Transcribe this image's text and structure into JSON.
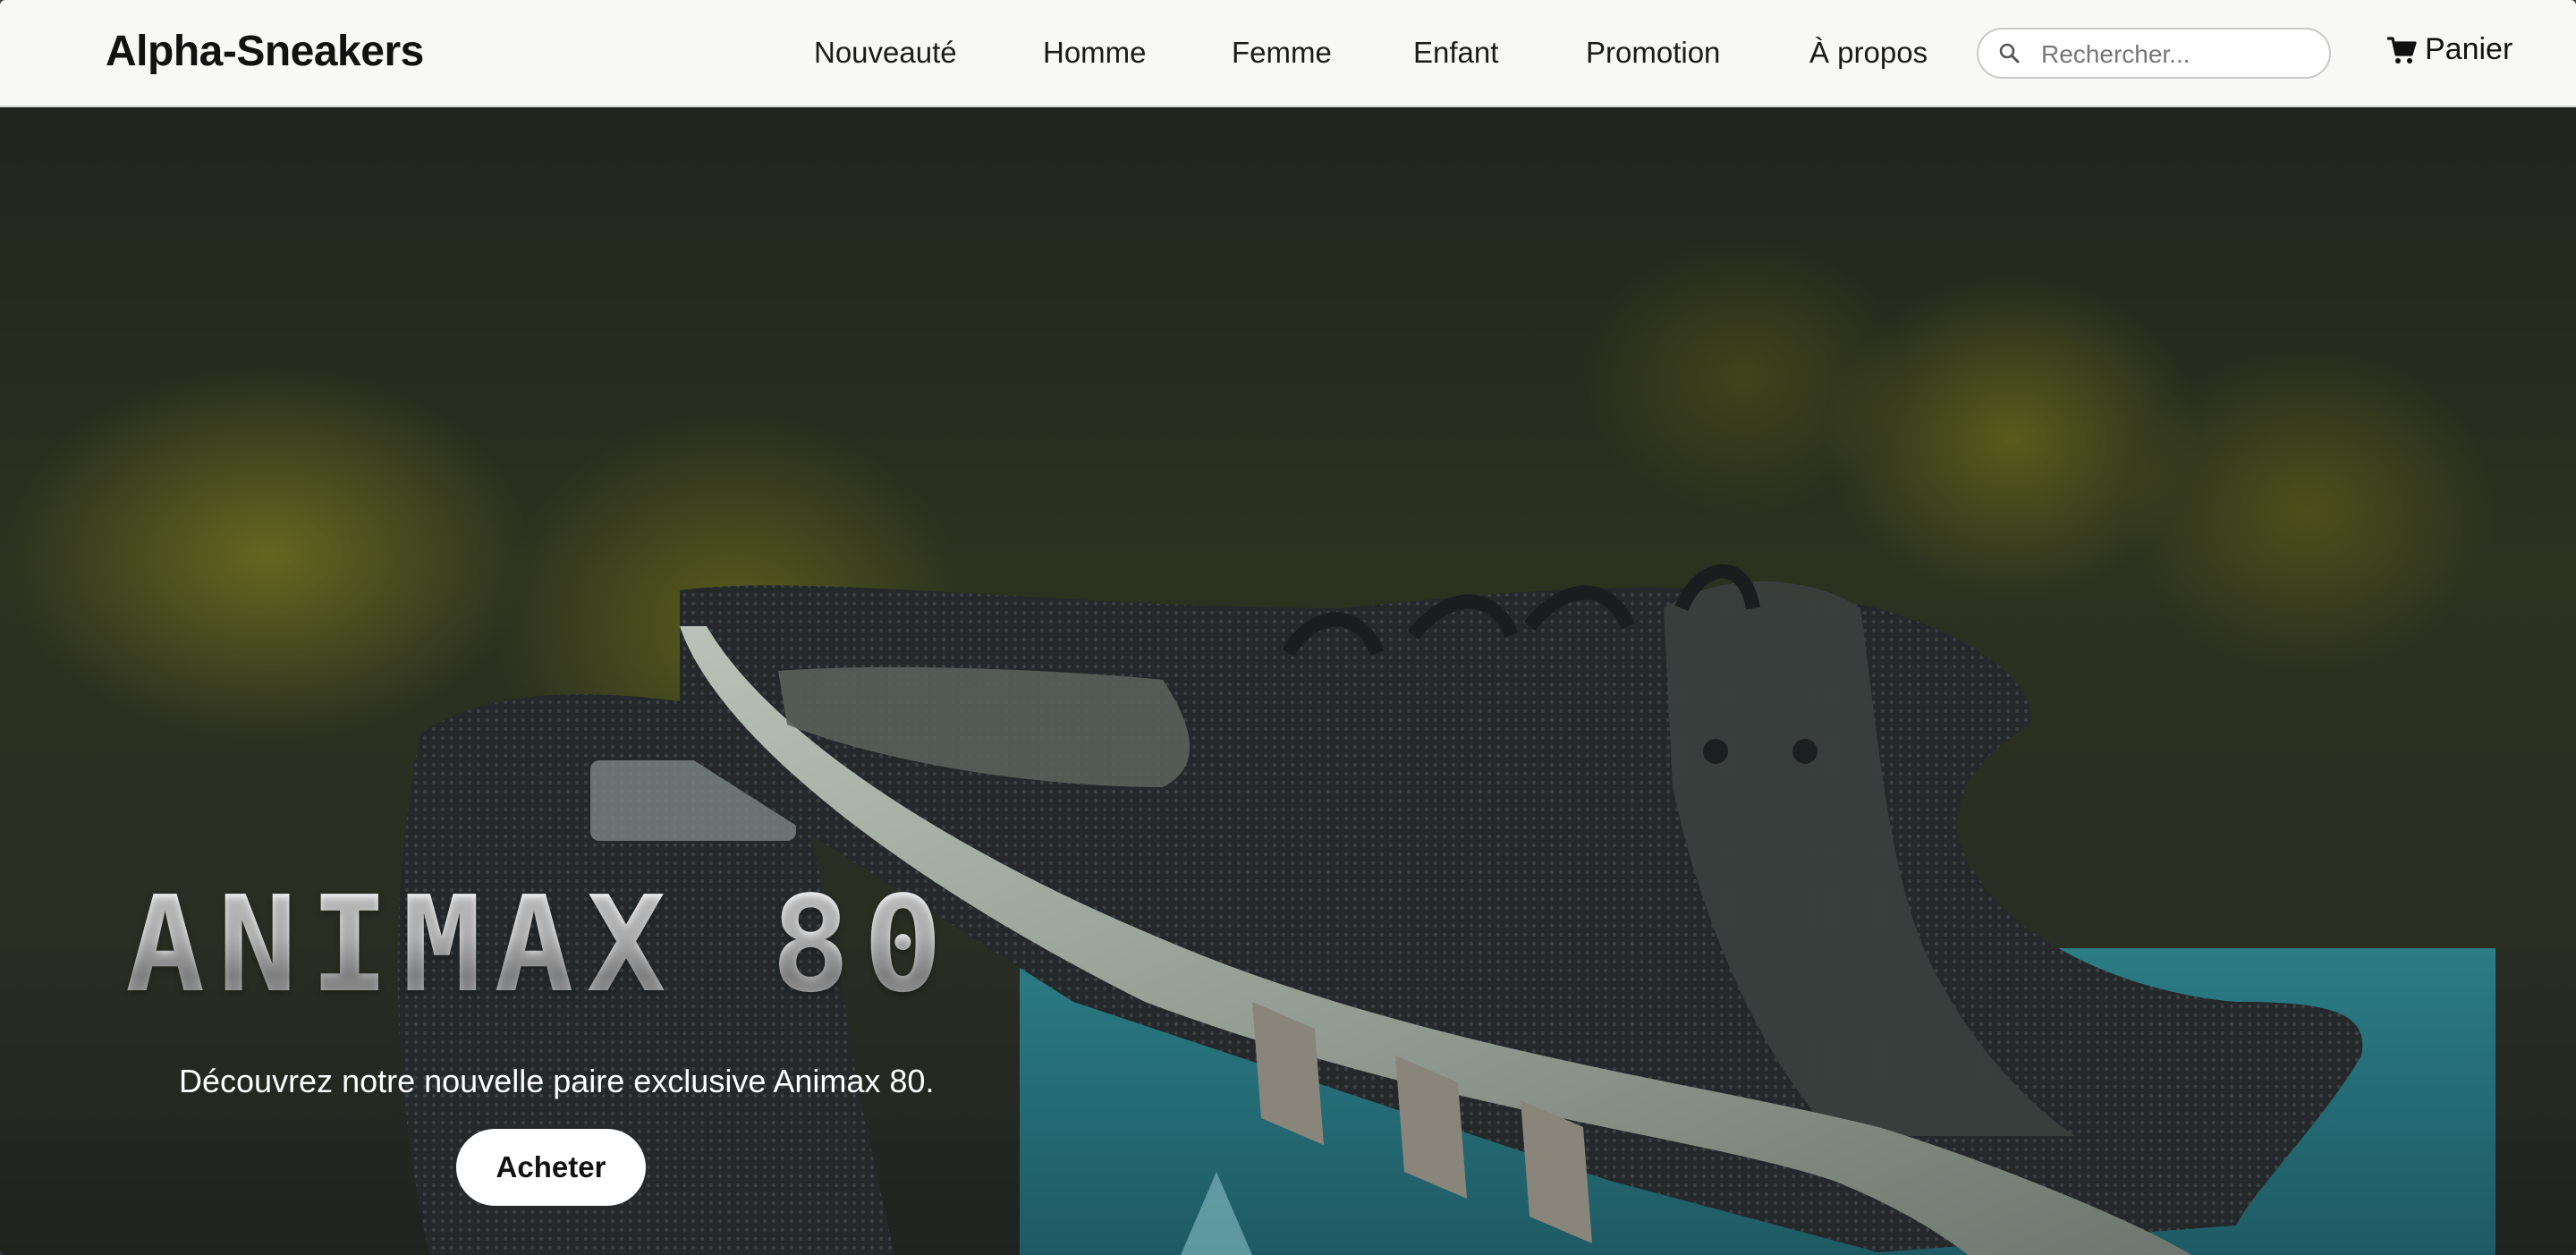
{
  "header": {
    "brand": "Alpha-Sneakers",
    "nav": [
      {
        "label": "Nouveauté"
      },
      {
        "label": "Homme"
      },
      {
        "label": "Femme"
      },
      {
        "label": "Enfant"
      },
      {
        "label": "Promotion"
      },
      {
        "label": "À propos"
      }
    ],
    "search": {
      "placeholder": "Rechercher...",
      "value": ""
    },
    "cart_label": "Panier"
  },
  "hero": {
    "title": "ANIMAX 80",
    "subtitle": "Découvrez notre nouvelle paire exclusive Animax 80.",
    "cta_label": "Acheter"
  },
  "colors": {
    "navbar_bg": "#f8f8f6",
    "hero_bg": "#2a2e22",
    "button_bg": "#ffffff",
    "accent_box": "#2a8fa0"
  },
  "icons": {
    "search": "search-icon",
    "cart": "cart-icon"
  }
}
